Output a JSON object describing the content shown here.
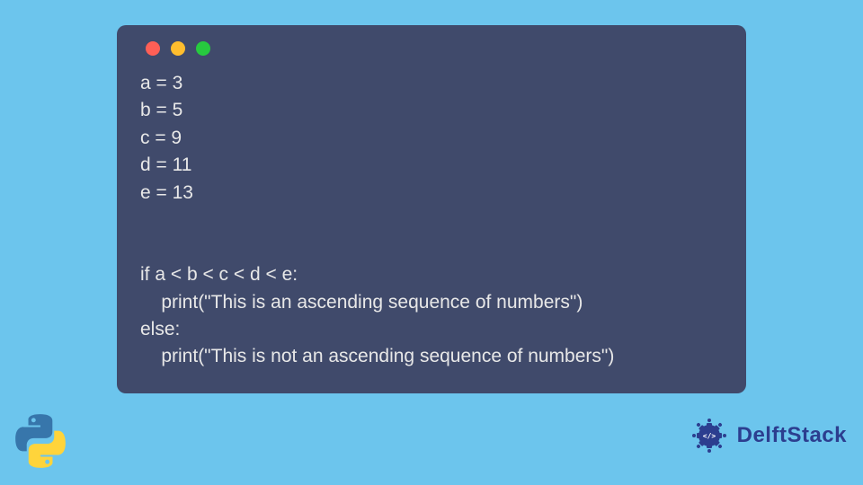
{
  "code": {
    "lines": [
      "a = 3",
      "b = 5",
      "c = 9",
      "d = 11",
      "e = 13",
      "",
      "",
      "if a < b < c < d < e:",
      "    print(\"This is an ascending sequence of numbers\")",
      "else:",
      "    print(\"This is not an ascending sequence of numbers\")"
    ]
  },
  "brand": {
    "name": "DelftStack"
  },
  "window": {
    "dots": [
      "red",
      "yellow",
      "green"
    ]
  }
}
